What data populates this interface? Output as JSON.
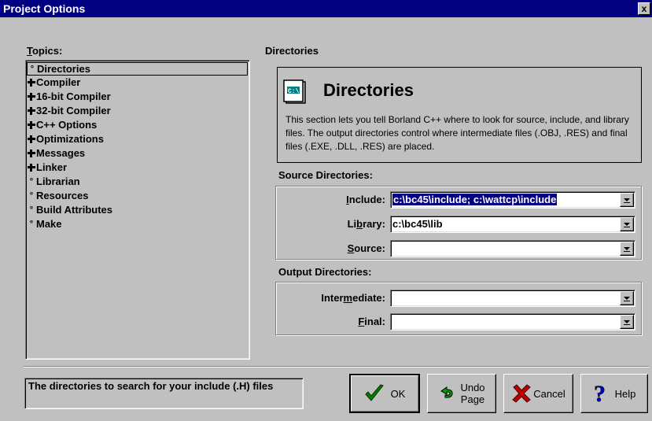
{
  "window": {
    "title": "Project Options",
    "close_label": "x"
  },
  "topics": {
    "label": "Topics:",
    "label_underline": "T",
    "label_rest": "opics:",
    "items": [
      {
        "label": "Directories",
        "marker": "bullet",
        "selected": true
      },
      {
        "label": "Compiler",
        "marker": "plus"
      },
      {
        "label": "16-bit Compiler",
        "marker": "plus"
      },
      {
        "label": "32-bit Compiler",
        "marker": "plus"
      },
      {
        "label": "C++ Options",
        "marker": "plus"
      },
      {
        "label": "Optimizations",
        "marker": "plus"
      },
      {
        "label": "Messages",
        "marker": "plus"
      },
      {
        "label": "Linker",
        "marker": "plus"
      },
      {
        "label": "Librarian",
        "marker": "bullet"
      },
      {
        "label": "Resources",
        "marker": "bullet"
      },
      {
        "label": "Build Attributes",
        "marker": "bullet"
      },
      {
        "label": "Make",
        "marker": "bullet"
      }
    ]
  },
  "section": {
    "label": "Directories",
    "title": "Directories",
    "icon": "directories-icon",
    "description": "This section lets you tell Borland C++ where to look for source, include, and library files.  The output directories control where intermediate files (.OBJ, .RES) and final files (.EXE, .DLL, .RES) are placed."
  },
  "source_dirs": {
    "label": "Source Directories:",
    "include": {
      "pre": "",
      "u": "I",
      "post": "nclude:",
      "value": "c:\\bc45\\include; c:\\wattcp\\include"
    },
    "library": {
      "pre": "Li",
      "u": "b",
      "post": "rary:",
      "value": "c:\\bc45\\lib"
    },
    "source": {
      "pre": "",
      "u": "S",
      "post": "ource:",
      "value": ""
    }
  },
  "output_dirs": {
    "label": "Output Directories:",
    "intermediate": {
      "pre": "Inter",
      "u": "m",
      "post": "ediate:",
      "value": ""
    },
    "final": {
      "pre": "",
      "u": "F",
      "post": "inal:",
      "value": ""
    }
  },
  "status_text": "The directories to search for your include (.H) files",
  "buttons": {
    "ok": "OK",
    "undo_line1": "Undo",
    "undo_line2": "Page",
    "cancel": "Cancel",
    "help": "Help"
  },
  "colors": {
    "titlebar": "#000080",
    "face": "#c0c0c0",
    "ok_check": "#008000",
    "cancel_x": "#c00000",
    "help_q": "#0000c0",
    "undo_arrow": "#008000"
  }
}
